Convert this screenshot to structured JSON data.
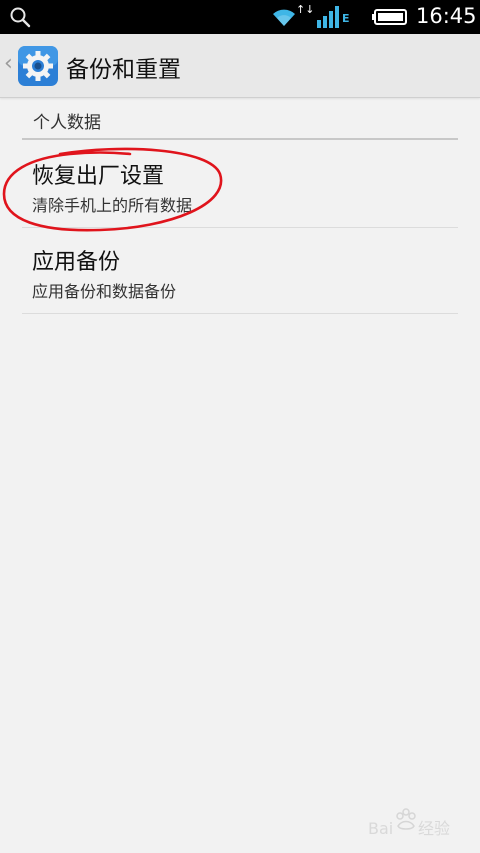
{
  "status_bar": {
    "time": "16:45",
    "network_type": "E",
    "icons": [
      "search-icon",
      "wifi-icon",
      "data-arrows-icon",
      "signal-icon",
      "battery-icon"
    ]
  },
  "action_bar": {
    "back_chevron": "‹",
    "title": "备份和重置",
    "icon": "settings-gear-icon"
  },
  "section": {
    "header": "个人数据"
  },
  "items": [
    {
      "title": "恢复出厂设置",
      "summary": "清除手机上的所有数据",
      "highlighted": true
    },
    {
      "title": "应用备份",
      "summary": "应用备份和数据备份",
      "highlighted": false
    }
  ],
  "colors": {
    "background": "#f2f2f2",
    "status_bar": "#000000",
    "accent_blue": "#3fb6e6",
    "annotation_red": "#e0141c"
  }
}
